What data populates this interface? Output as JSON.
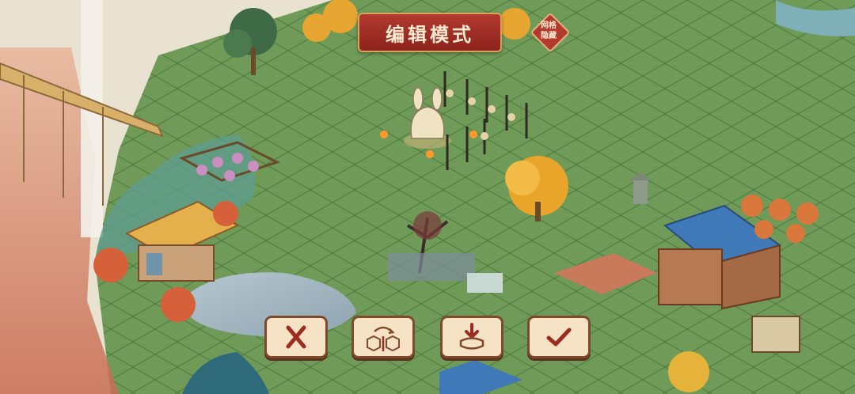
{
  "header": {
    "mode_title": "编辑模式",
    "grid_toggle_label_line1": "网格",
    "grid_toggle_label_line2": "隐藏"
  },
  "toolbar": {
    "buttons": [
      {
        "name": "cancel",
        "icon": "close-icon"
      },
      {
        "name": "rotate",
        "icon": "flip-rotate-icon"
      },
      {
        "name": "store",
        "icon": "store-in-inventory-icon"
      },
      {
        "name": "confirm",
        "icon": "checkmark-icon"
      }
    ]
  },
  "colors": {
    "grass": "#6f9a58",
    "grid_line": "#4f7a3e",
    "button_fill": "#f6e3c6",
    "button_border": "#7f4a2c",
    "banner_red": "#a22f26",
    "icon_red": "#9d2b22"
  }
}
